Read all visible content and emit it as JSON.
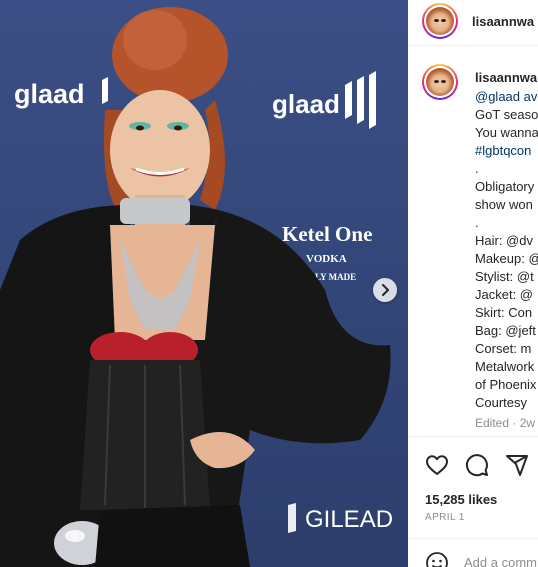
{
  "photo": {
    "backdrop_texts": [
      "glaad",
      "glaad",
      "Ketel One",
      "VODKA",
      "LY MADE",
      "glaa",
      "GILEAD"
    ],
    "next_icon": "chevron-right-icon"
  },
  "header": {
    "username": "lisaannwa"
  },
  "caption": {
    "username": "lisaannwa",
    "lines": [
      {
        "text": "@glaad av",
        "link": true
      },
      {
        "text": "GoT seaso",
        "link": false
      },
      {
        "text": "You wanna",
        "link": false
      },
      {
        "text": "#lgbtqcon",
        "link": true
      },
      {
        "text": ".",
        "link": false
      },
      {
        "text": "Obligatory",
        "link": false
      },
      {
        "text": "show won",
        "link": false
      },
      {
        "text": ".",
        "link": false
      },
      {
        "text": "Hair: @dv",
        "link": false
      },
      {
        "text": "Makeup: @",
        "link": false
      },
      {
        "text": "Stylist: @t",
        "link": false
      },
      {
        "text": "Jacket: @",
        "link": false
      },
      {
        "text": "Skirt: Con",
        "link": false
      },
      {
        "text": "Bag: @jeft",
        "link": false
      },
      {
        "text": "Corset: m",
        "link": false
      },
      {
        "text": "Metalwork",
        "link": false
      },
      {
        "text": "of Phoenix",
        "link": false
      },
      {
        "text": "Courtesy",
        "link": false
      }
    ],
    "edited": "Edited · 2w"
  },
  "actions": {
    "like_icon": "heart-icon",
    "comment_icon": "comment-icon",
    "share_icon": "share-icon"
  },
  "likes": "15,285 likes",
  "date": "APRIL 1",
  "comment": {
    "placeholder": "Add a comm",
    "emoji_icon": "emoji-icon"
  },
  "colors": {
    "link": "#00376b",
    "muted": "#8e8e8e",
    "backdrop": "#34477a"
  }
}
